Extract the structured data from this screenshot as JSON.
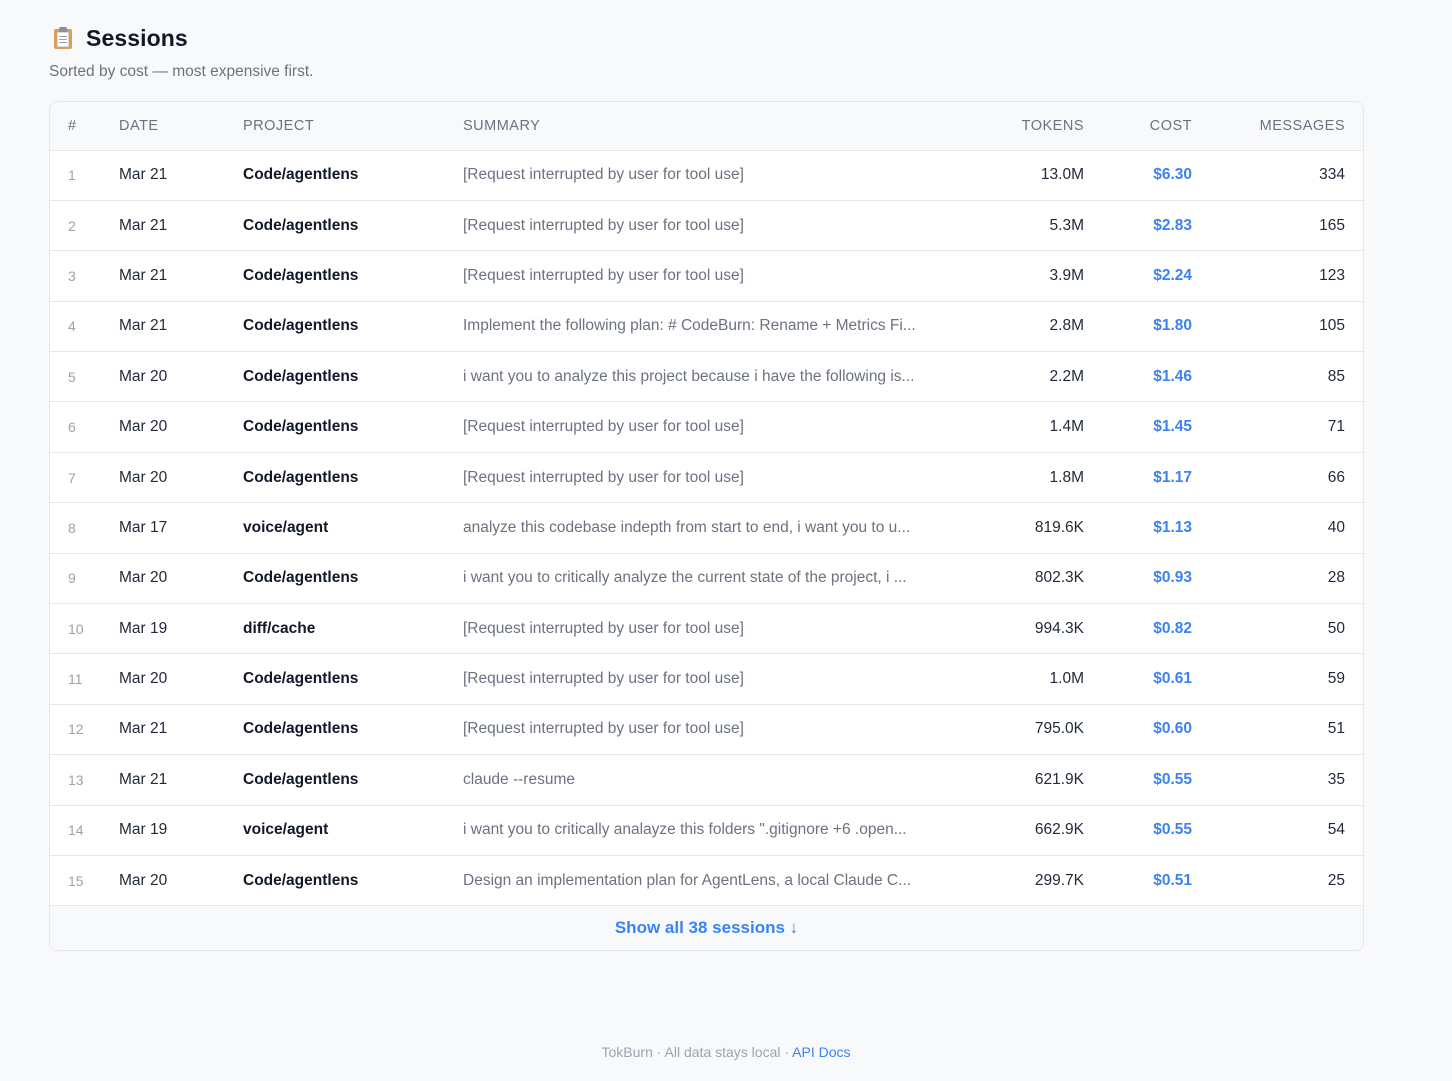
{
  "header": {
    "icon": "clipboard-icon",
    "title": "Sessions",
    "subtitle": "Sorted by cost — most expensive first."
  },
  "table": {
    "columns": {
      "num": "#",
      "date": "DATE",
      "project": "PROJECT",
      "summary": "SUMMARY",
      "tokens": "TOKENS",
      "cost": "COST",
      "messages": "MESSAGES"
    },
    "rows": [
      {
        "num": "1",
        "date": "Mar 21",
        "project": "Code/agentlens",
        "summary": "[Request interrupted by user for tool use]",
        "tokens": "13.0M",
        "cost": "$6.30",
        "messages": "334"
      },
      {
        "num": "2",
        "date": "Mar 21",
        "project": "Code/agentlens",
        "summary": "[Request interrupted by user for tool use]",
        "tokens": "5.3M",
        "cost": "$2.83",
        "messages": "165"
      },
      {
        "num": "3",
        "date": "Mar 21",
        "project": "Code/agentlens",
        "summary": "[Request interrupted by user for tool use]",
        "tokens": "3.9M",
        "cost": "$2.24",
        "messages": "123"
      },
      {
        "num": "4",
        "date": "Mar 21",
        "project": "Code/agentlens",
        "summary": "Implement the following plan: # CodeBurn: Rename + Metrics Fi...",
        "tokens": "2.8M",
        "cost": "$1.80",
        "messages": "105"
      },
      {
        "num": "5",
        "date": "Mar 20",
        "project": "Code/agentlens",
        "summary": "i want you to analyze this project because i have the following is...",
        "tokens": "2.2M",
        "cost": "$1.46",
        "messages": "85"
      },
      {
        "num": "6",
        "date": "Mar 20",
        "project": "Code/agentlens",
        "summary": "[Request interrupted by user for tool use]",
        "tokens": "1.4M",
        "cost": "$1.45",
        "messages": "71"
      },
      {
        "num": "7",
        "date": "Mar 20",
        "project": "Code/agentlens",
        "summary": "[Request interrupted by user for tool use]",
        "tokens": "1.8M",
        "cost": "$1.17",
        "messages": "66"
      },
      {
        "num": "8",
        "date": "Mar 17",
        "project": "voice/agent",
        "summary": "analyze this codebase indepth from start to end, i want you to u...",
        "tokens": "819.6K",
        "cost": "$1.13",
        "messages": "40"
      },
      {
        "num": "9",
        "date": "Mar 20",
        "project": "Code/agentlens",
        "summary": "i want you to critically analyze the current state of the project, i ...",
        "tokens": "802.3K",
        "cost": "$0.93",
        "messages": "28"
      },
      {
        "num": "10",
        "date": "Mar 19",
        "project": "diff/cache",
        "summary": "[Request interrupted by user for tool use]",
        "tokens": "994.3K",
        "cost": "$0.82",
        "messages": "50"
      },
      {
        "num": "11",
        "date": "Mar 20",
        "project": "Code/agentlens",
        "summary": "[Request interrupted by user for tool use]",
        "tokens": "1.0M",
        "cost": "$0.61",
        "messages": "59"
      },
      {
        "num": "12",
        "date": "Mar 21",
        "project": "Code/agentlens",
        "summary": "[Request interrupted by user for tool use]",
        "tokens": "795.0K",
        "cost": "$0.60",
        "messages": "51"
      },
      {
        "num": "13",
        "date": "Mar 21",
        "project": "Code/agentlens",
        "summary": "claude --resume",
        "tokens": "621.9K",
        "cost": "$0.55",
        "messages": "35"
      },
      {
        "num": "14",
        "date": "Mar 19",
        "project": "voice/agent",
        "summary": "i want you to critically analayze this folders \".gitignore +6 .open...",
        "tokens": "662.9K",
        "cost": "$0.55",
        "messages": "54"
      },
      {
        "num": "15",
        "date": "Mar 20",
        "project": "Code/agentlens",
        "summary": "Design an implementation plan for AgentLens, a local Claude C...",
        "tokens": "299.7K",
        "cost": "$0.51",
        "messages": "25"
      }
    ],
    "show_all_label": "Show all 38 sessions ↓"
  },
  "footer": {
    "text": "TokBurn · All data stays local · ",
    "api_docs_label": "API Docs"
  },
  "colors": {
    "accent": "#3b82f6",
    "background": "#f8f9fb",
    "border": "#e5e7eb",
    "muted_text": "#6b7280"
  }
}
